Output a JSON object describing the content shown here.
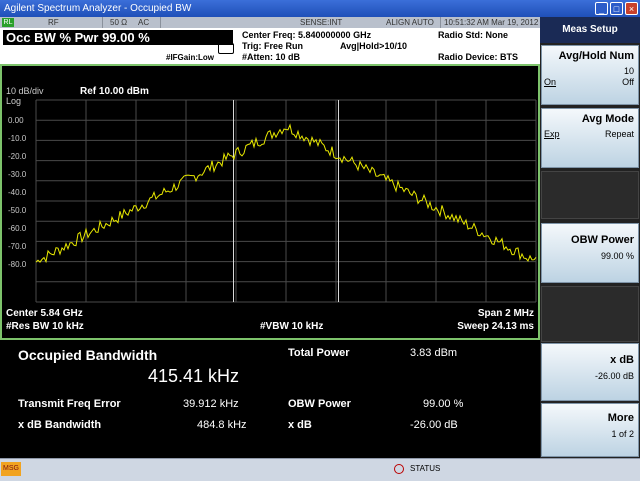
{
  "window": {
    "title": "Agilent Spectrum Analyzer - Occupied BW"
  },
  "status_bar": {
    "flag": "RL",
    "rf": "RF",
    "impedance": "50 Ω",
    "coupling": "AC",
    "sense": "SENSE:INT",
    "align": "ALIGN AUTO",
    "datetime": "10:51:32 AM Mar 19, 2012"
  },
  "meas": {
    "title": "Occ BW % Pwr  99.00 %",
    "gain": "#IFGain:Low",
    "center_freq": "Center Freq: 5.840000000 GHz",
    "trig": "Trig: Free Run",
    "avg_hold": "Avg|Hold>10/10",
    "atten": "#Atten: 10 dB",
    "radio_std": "Radio Std: None",
    "radio_device": "Radio Device: BTS"
  },
  "graticule": {
    "scale": "10 dB/div",
    "log": "Log",
    "ref": "Ref 10.00 dBm",
    "y_labels": [
      "0.00",
      "-10.0",
      "-20.0",
      "-30.0",
      "-40.0",
      "-50.0",
      "-60.0",
      "-70.0",
      "-80.0"
    ],
    "center": "Center  5.84 GHz",
    "res_bw": "#Res BW  10 kHz",
    "vbw": "#VBW  10 kHz",
    "span": "Span 2 MHz",
    "sweep": "Sweep  24.13 ms"
  },
  "results": {
    "occupied_bw_label": "Occupied Bandwidth",
    "occupied_bw_value": "415.41 kHz",
    "total_power_label": "Total Power",
    "total_power_value": "3.83 dBm",
    "transmit_freq_error_label": "Transmit Freq Error",
    "transmit_freq_error_value": "39.912 kHz",
    "obw_power_label": "OBW Power",
    "obw_power_value": "99.00 %",
    "xdb_bandwidth_label": "x dB Bandwidth",
    "xdb_bandwidth_value": "484.8 kHz",
    "xdb_label": "x dB",
    "xdb_value": "-26.00 dB"
  },
  "side_panel": {
    "title": "Meas Setup",
    "avg_hold_label": "Avg/Hold Num",
    "avg_hold_value": "10",
    "avg_hold_on": "On",
    "avg_hold_off": "Off",
    "avg_mode_label": "Avg Mode",
    "avg_mode_exp": "Exp",
    "avg_mode_repeat": "Repeat",
    "obw_power_label": "OBW Power",
    "obw_power_value": "99.00 %",
    "xdb_label": "x dB",
    "xdb_value": "-26.00 dB",
    "more_label": "More",
    "more_page": "1 of 2"
  },
  "bottom": {
    "msg": "MSG",
    "status": "STATUS"
  },
  "colors": {
    "trace": "#e8e800",
    "graticule_border": "#7dc36b",
    "grid": "#4a4a4a",
    "window_title": "#1f4fb8"
  },
  "trace_shape": {
    "channel_marker_left_mhz": 5.83979,
    "channel_marker_right_mhz": 5.84021,
    "peak_dbm": -3,
    "edge_dbm": -67
  }
}
